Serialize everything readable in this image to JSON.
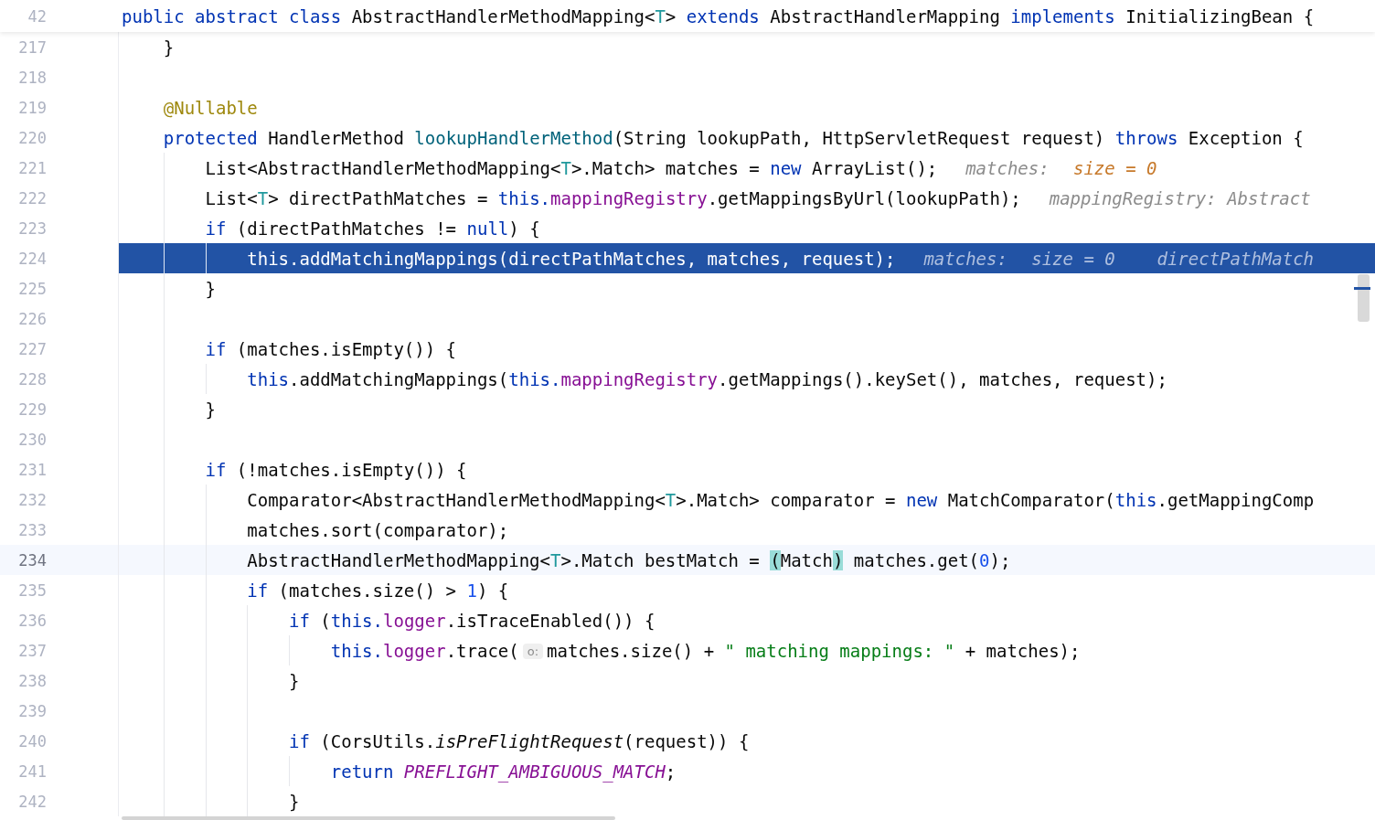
{
  "header": {
    "number": "42",
    "tokens": [
      {
        "text": "public abstract class",
        "kind": "keyword"
      },
      {
        "text": " AbstractHandlerMethodMapping<",
        "kind": "plain"
      },
      {
        "text": "T",
        "kind": "type-param"
      },
      {
        "text": "> ",
        "kind": "plain"
      },
      {
        "text": "extends",
        "kind": "keyword"
      },
      {
        "text": " AbstractHandlerMapping ",
        "kind": "plain"
      },
      {
        "text": "implements",
        "kind": "keyword"
      },
      {
        "text": " InitializingBean {",
        "kind": "plain"
      }
    ]
  },
  "lines": [
    {
      "number": "217",
      "execution_point": false,
      "caret_line": false,
      "tokens": [
        {
          "text": "    }",
          "kind": "plain"
        }
      ]
    },
    {
      "number": "218",
      "execution_point": false,
      "caret_line": false
    },
    {
      "number": "219",
      "execution_point": false,
      "caret_line": false,
      "tokens": [
        {
          "text": "    @Nullable",
          "kind": "annotation"
        }
      ]
    },
    {
      "number": "220",
      "execution_point": false,
      "caret_line": false,
      "tokens": [
        {
          "text": "    protected",
          "kind": "keyword"
        },
        {
          "text": " HandlerMethod ",
          "kind": "plain"
        },
        {
          "text": "lookupHandlerMethod",
          "kind": "method-decl"
        },
        {
          "text": "(String lookupPath, HttpServletRequest request) ",
          "kind": "plain"
        },
        {
          "text": "throws",
          "kind": "keyword"
        },
        {
          "text": " Exception {",
          "kind": "plain"
        }
      ]
    },
    {
      "number": "221",
      "execution_point": false,
      "caret_line": false,
      "tokens": [
        {
          "text": "        List<AbstractHandlerMethodMapping<",
          "kind": "plain"
        },
        {
          "text": "T",
          "kind": "type-param"
        },
        {
          "text": ">.Match> matches = ",
          "kind": "plain"
        },
        {
          "text": "new",
          "kind": "keyword"
        },
        {
          "text": " ArrayList();",
          "kind": "plain"
        }
      ],
      "hints": [
        {
          "label": "matches:",
          "value": "size = 0"
        }
      ]
    },
    {
      "number": "222",
      "execution_point": false,
      "caret_line": false,
      "tokens": [
        {
          "text": "        List<",
          "kind": "plain"
        },
        {
          "text": "T",
          "kind": "type-param"
        },
        {
          "text": "> directPathMatches = ",
          "kind": "plain"
        },
        {
          "text": "this.",
          "kind": "keyword"
        },
        {
          "text": "mappingRegistry",
          "kind": "field"
        },
        {
          "text": ".getMappingsByUrl(lookupPath);",
          "kind": "plain"
        }
      ],
      "hints": [
        {
          "label": "mappingRegistry: Abstract"
        }
      ]
    },
    {
      "number": "223",
      "execution_point": false,
      "caret_line": false,
      "tokens": [
        {
          "text": "        if",
          "kind": "keyword"
        },
        {
          "text": " (directPathMatches != ",
          "kind": "plain"
        },
        {
          "text": "null",
          "kind": "keyword"
        },
        {
          "text": ") {",
          "kind": "plain"
        }
      ]
    },
    {
      "number": "224",
      "execution_point": true,
      "caret_line": false,
      "tokens": [
        {
          "text": "            this",
          "kind": "keyword"
        },
        {
          "text": ".addMatchingMappings(directPathMatches, matches, request);",
          "kind": "plain"
        }
      ],
      "hints": [
        {
          "label": "matches:",
          "value": "size = 0"
        },
        {
          "label": "directPathMatch"
        }
      ]
    },
    {
      "number": "225",
      "execution_point": false,
      "caret_line": false,
      "tokens": [
        {
          "text": "        }",
          "kind": "plain"
        }
      ]
    },
    {
      "number": "226",
      "execution_point": false,
      "caret_line": false
    },
    {
      "number": "227",
      "execution_point": false,
      "caret_line": false,
      "tokens": [
        {
          "text": "        if",
          "kind": "keyword"
        },
        {
          "text": " (matches.isEmpty()) {",
          "kind": "plain"
        }
      ]
    },
    {
      "number": "228",
      "execution_point": false,
      "caret_line": false,
      "tokens": [
        {
          "text": "            this",
          "kind": "keyword"
        },
        {
          "text": ".addMatchingMappings(",
          "kind": "plain"
        },
        {
          "text": "this.",
          "kind": "keyword"
        },
        {
          "text": "mappingRegistry",
          "kind": "field"
        },
        {
          "text": ".getMappings().keySet(), matches, request);",
          "kind": "plain"
        }
      ]
    },
    {
      "number": "229",
      "execution_point": false,
      "caret_line": false,
      "tokens": [
        {
          "text": "        }",
          "kind": "plain"
        }
      ]
    },
    {
      "number": "230",
      "execution_point": false,
      "caret_line": false
    },
    {
      "number": "231",
      "execution_point": false,
      "caret_line": false,
      "tokens": [
        {
          "text": "        if",
          "kind": "keyword"
        },
        {
          "text": " (!matches.isEmpty()) {",
          "kind": "plain"
        }
      ]
    },
    {
      "number": "232",
      "execution_point": false,
      "caret_line": false,
      "tokens": [
        {
          "text": "            Comparator<AbstractHandlerMethodMapping<",
          "kind": "plain"
        },
        {
          "text": "T",
          "kind": "type-param"
        },
        {
          "text": ">.Match> comparator = ",
          "kind": "plain"
        },
        {
          "text": "new",
          "kind": "keyword"
        },
        {
          "text": " MatchComparator(",
          "kind": "plain"
        },
        {
          "text": "this",
          "kind": "keyword"
        },
        {
          "text": ".getMappingComp",
          "kind": "plain"
        }
      ]
    },
    {
      "number": "233",
      "execution_point": false,
      "caret_line": false,
      "tokens": [
        {
          "text": "            matches.sort(comparator);",
          "kind": "plain"
        }
      ]
    },
    {
      "number": "234",
      "execution_point": false,
      "caret_line": true,
      "tokens": [
        {
          "text": "            AbstractHandlerMethodMapping<",
          "kind": "plain"
        },
        {
          "text": "T",
          "kind": "type-param"
        },
        {
          "text": ">.Match bestMatch = ",
          "kind": "plain"
        },
        {
          "text": "(",
          "kind": "brace-match"
        },
        {
          "text": "Match",
          "kind": "plain"
        },
        {
          "text": ")",
          "kind": "brace-match"
        },
        {
          "text": " matches.get(",
          "kind": "plain"
        },
        {
          "text": "0",
          "kind": "number"
        },
        {
          "text": ");",
          "kind": "plain"
        }
      ]
    },
    {
      "number": "235",
      "execution_point": false,
      "caret_line": false,
      "tokens": [
        {
          "text": "            if",
          "kind": "keyword"
        },
        {
          "text": " (matches.size() > ",
          "kind": "plain"
        },
        {
          "text": "1",
          "kind": "number"
        },
        {
          "text": ") {",
          "kind": "plain"
        }
      ]
    },
    {
      "number": "236",
      "execution_point": false,
      "caret_line": false,
      "tokens": [
        {
          "text": "                if",
          "kind": "keyword"
        },
        {
          "text": " (",
          "kind": "plain"
        },
        {
          "text": "this.",
          "kind": "keyword"
        },
        {
          "text": "logger",
          "kind": "field"
        },
        {
          "text": ".isTraceEnabled()) {",
          "kind": "plain"
        }
      ]
    },
    {
      "number": "237",
      "execution_point": false,
      "caret_line": false,
      "tokens": [
        {
          "text": "                    this.",
          "kind": "keyword"
        },
        {
          "text": "logger",
          "kind": "field"
        },
        {
          "text": ".trace(",
          "kind": "plain"
        },
        {
          "text": "o:",
          "kind": "param-hint"
        },
        {
          "text": "matches.size() + ",
          "kind": "plain"
        },
        {
          "text": "\" matching mappings: \"",
          "kind": "string"
        },
        {
          "text": " + matches);",
          "kind": "plain"
        }
      ]
    },
    {
      "number": "238",
      "execution_point": false,
      "caret_line": false,
      "tokens": [
        {
          "text": "                }",
          "kind": "plain"
        }
      ]
    },
    {
      "number": "239",
      "execution_point": false,
      "caret_line": false
    },
    {
      "number": "240",
      "execution_point": false,
      "caret_line": false,
      "tokens": [
        {
          "text": "                if",
          "kind": "keyword"
        },
        {
          "text": " (CorsUtils.",
          "kind": "plain"
        },
        {
          "text": "isPreFlightRequest",
          "kind": "static-call"
        },
        {
          "text": "(request)) {",
          "kind": "plain"
        }
      ]
    },
    {
      "number": "241",
      "execution_point": false,
      "caret_line": false,
      "tokens": [
        {
          "text": "                    return ",
          "kind": "keyword"
        },
        {
          "text": "PREFLIGHT_AMBIGUOUS_MATCH",
          "kind": "constant"
        },
        {
          "text": ";",
          "kind": "plain"
        }
      ]
    },
    {
      "number": "242",
      "execution_point": false,
      "caret_line": false,
      "tokens": [
        {
          "text": "                }",
          "kind": "plain"
        }
      ]
    }
  ]
}
